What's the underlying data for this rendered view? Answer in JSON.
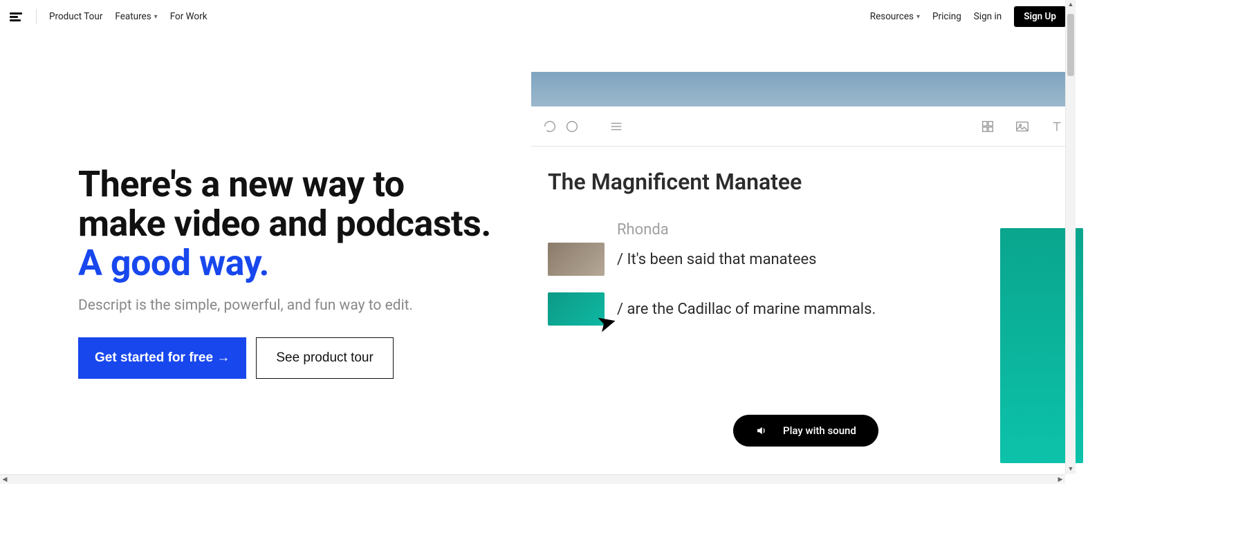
{
  "nav": {
    "product_tour": "Product Tour",
    "features": "Features",
    "for_work": "For Work",
    "resources": "Resources",
    "pricing": "Pricing",
    "sign_in": "Sign in",
    "sign_up": "Sign Up"
  },
  "hero": {
    "headline_a": "There's a new way to make video and podcasts. ",
    "headline_b": "A good way.",
    "subhead": "Descript is the simple, powerful, and fun way to edit.",
    "cta_primary": "Get started for free →",
    "cta_secondary": "See product tour"
  },
  "demo": {
    "title": "The Magnificent Manatee",
    "speaker": "Rhonda",
    "line1": "/ It's been said that manatees",
    "line2": "/ are the Cadillac of marine mammals."
  },
  "play": {
    "label": "Play with sound"
  }
}
